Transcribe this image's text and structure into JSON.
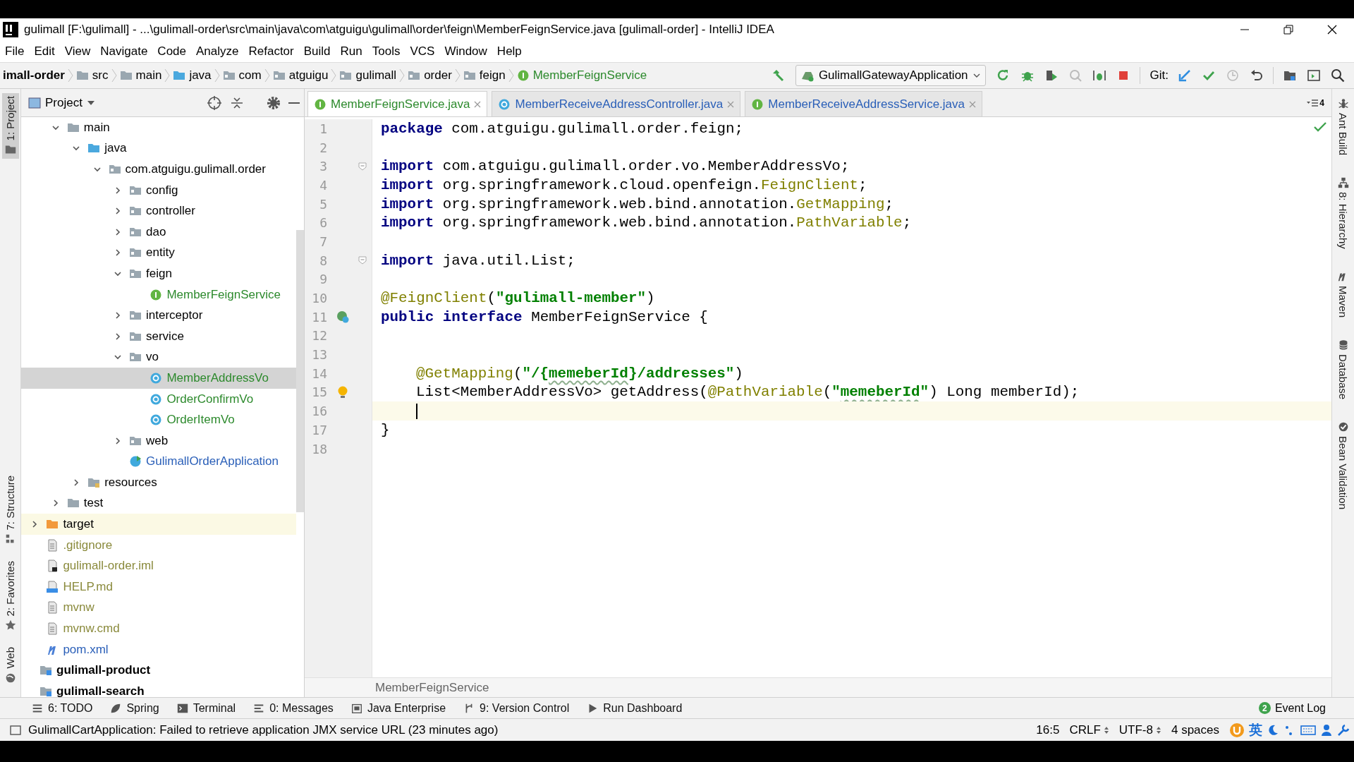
{
  "window": {
    "title": "gulimall [F:\\gulimall] - ...\\gulimall-order\\src\\main\\java\\com\\atguigu\\gulimall\\order\\feign\\MemberFeignService.java [gulimall-order] - IntelliJ IDEA"
  },
  "menu": [
    "File",
    "Edit",
    "View",
    "Navigate",
    "Code",
    "Analyze",
    "Refactor",
    "Build",
    "Run",
    "Tools",
    "VCS",
    "Window",
    "Help"
  ],
  "navbar": {
    "module": "imall-order",
    "crumbs": [
      {
        "label": "src",
        "kind": "folder"
      },
      {
        "label": "main",
        "kind": "folder"
      },
      {
        "label": "java",
        "kind": "source"
      },
      {
        "label": "com",
        "kind": "package"
      },
      {
        "label": "atguigu",
        "kind": "package"
      },
      {
        "label": "gulimall",
        "kind": "package"
      },
      {
        "label": "order",
        "kind": "package"
      },
      {
        "label": "feign",
        "kind": "package"
      },
      {
        "label": "MemberFeignService",
        "kind": "interface",
        "color": "#2d8a2d"
      }
    ],
    "run_config": "GulimallGatewayApplication",
    "git_label": "Git:",
    "tools": [
      {
        "kind": "rerun",
        "disabled": false
      },
      {
        "kind": "debug",
        "disabled": false
      },
      {
        "kind": "coverage",
        "disabled": false
      },
      {
        "kind": "profile",
        "disabled": true
      },
      {
        "kind": "attach",
        "disabled": false
      },
      {
        "kind": "stop",
        "disabled": false
      }
    ],
    "git_tools": [
      {
        "kind": "update",
        "disabled": false
      },
      {
        "kind": "commit",
        "disabled": false
      },
      {
        "kind": "history",
        "disabled": true
      },
      {
        "kind": "revert",
        "disabled": false
      }
    ]
  },
  "left_stripe": {
    "top": [
      {
        "label": "1: Project",
        "selected": true,
        "kind": "project"
      }
    ],
    "bottom": [
      {
        "label": "7: Structure",
        "selected": false,
        "kind": "structure"
      },
      {
        "label": "2: Favorites",
        "selected": false,
        "kind": "favorites"
      },
      {
        "label": "Web",
        "selected": false,
        "kind": "web"
      }
    ]
  },
  "right_stripe": [
    {
      "label": "Ant Build",
      "kind": "ant"
    },
    {
      "label": "8: Hierarchy",
      "kind": "hierarchy"
    },
    {
      "label": "Maven",
      "kind": "maven"
    },
    {
      "label": "Database",
      "kind": "database"
    },
    {
      "label": "Bean Validation",
      "kind": "bean"
    }
  ],
  "project_panel": {
    "title": "Project",
    "tree": [
      {
        "children": [
          {
            "children": [
              {
                "label": "main",
                "kind": "folder",
                "expanded": true,
                "children": [
                  {
                    "label": "java",
                    "kind": "source",
                    "expanded": true,
                    "children": [
                      {
                        "label": "com.atguigu.gulimall.order",
                        "kind": "package",
                        "expanded": true,
                        "children": [
                          {
                            "label": "config",
                            "kind": "package",
                            "expanded": false
                          },
                          {
                            "label": "controller",
                            "kind": "package",
                            "expanded": false
                          },
                          {
                            "label": "dao",
                            "kind": "package",
                            "expanded": false
                          },
                          {
                            "label": "entity",
                            "kind": "package",
                            "expanded": false
                          },
                          {
                            "label": "feign",
                            "kind": "package",
                            "expanded": true,
                            "children": [
                              {
                                "label": "MemberFeignService",
                                "kind": "interface",
                                "color": "#2d8a2d",
                                "selected": false
                              }
                            ]
                          },
                          {
                            "label": "interceptor",
                            "kind": "package",
                            "expanded": false
                          },
                          {
                            "label": "service",
                            "kind": "package",
                            "expanded": false
                          },
                          {
                            "label": "vo",
                            "kind": "package",
                            "expanded": true,
                            "children": [
                              {
                                "label": "MemberAddressVo",
                                "kind": "class",
                                "color": "#2d8a2d",
                                "selected": true
                              },
                              {
                                "label": "OrderConfirmVo",
                                "kind": "class",
                                "color": "#2d8a2d",
                                "selected": false
                              },
                              {
                                "label": "OrderItemVo",
                                "kind": "class",
                                "color": "#2d8a2d",
                                "selected": false
                              }
                            ]
                          },
                          {
                            "label": "web",
                            "kind": "package",
                            "expanded": false
                          },
                          {
                            "label": "GulimallOrderApplication",
                            "kind": "app",
                            "color": "#2a5fb8",
                            "selected": false
                          }
                        ]
                      }
                    ]
                  },
                  {
                    "label": "resources",
                    "kind": "resources",
                    "expanded": false
                  }
                ]
              },
              {
                "label": "test",
                "kind": "folder",
                "expanded": false
              }
            ]
          },
          {
            "label": "target",
            "kind": "excluded",
            "expanded": false,
            "highlighted": true
          },
          {
            "label": ".gitignore",
            "kind": "file",
            "color": "#8a8a3c"
          },
          {
            "label": "gulimall-order.iml",
            "kind": "iml",
            "color": "#8a8a3c"
          },
          {
            "label": "HELP.md",
            "kind": "md",
            "color": "#8a8a3c"
          },
          {
            "label": "mvnw",
            "kind": "file",
            "color": "#8a8a3c"
          },
          {
            "label": "mvnw.cmd",
            "kind": "file",
            "color": "#8a8a3c"
          },
          {
            "label": "pom.xml",
            "kind": "maven",
            "color": "#2a5fb8"
          }
        ]
      },
      {
        "label": "gulimall-product",
        "kind": "module"
      },
      {
        "label": "gulimall-search",
        "kind": "module"
      }
    ]
  },
  "editor": {
    "tabs": [
      {
        "label": "MemberFeignService.java",
        "kind": "interface",
        "color": "#2d8a2d",
        "selected": true
      },
      {
        "label": "MemberReceiveAddressController.java",
        "kind": "class",
        "color": "#2a5fb8",
        "selected": false
      },
      {
        "label": "MemberReceiveAddressService.java",
        "kind": "interface",
        "color": "#2a5fb8",
        "selected": false
      }
    ],
    "tab_count": "4",
    "lines": [
      {
        "number": "1",
        "tokens": [
          {
            "t": "package",
            "kind": "keyword"
          },
          {
            "t": " com.atguigu.gulimall.order.feign;",
            "kind": "plain"
          }
        ]
      },
      {
        "number": "2"
      },
      {
        "number": "3",
        "kind": "fold",
        "tokens": [
          {
            "t": "import",
            "kind": "keyword"
          },
          {
            "t": " com.atguigu.gulimall.order.vo.MemberAddressVo;",
            "kind": "plain"
          }
        ]
      },
      {
        "number": "4",
        "tokens": [
          {
            "t": "import",
            "kind": "keyword"
          },
          {
            "t": " org.springframework.cloud.openfeign.",
            "kind": "plain"
          },
          {
            "t": "FeignClient",
            "kind": "annotation"
          },
          {
            "t": ";",
            "kind": "plain"
          }
        ]
      },
      {
        "number": "5",
        "tokens": [
          {
            "t": "import",
            "kind": "keyword"
          },
          {
            "t": " org.springframework.web.bind.annotation.",
            "kind": "plain"
          },
          {
            "t": "GetMapping",
            "kind": "annotation"
          },
          {
            "t": ";",
            "kind": "plain"
          }
        ]
      },
      {
        "number": "6",
        "tokens": [
          {
            "t": "import",
            "kind": "keyword"
          },
          {
            "t": " org.springframework.web.bind.annotation.",
            "kind": "plain"
          },
          {
            "t": "PathVariable",
            "kind": "annotation"
          },
          {
            "t": ";",
            "kind": "plain"
          }
        ]
      },
      {
        "number": "7"
      },
      {
        "number": "8",
        "kind": "fold",
        "tokens": [
          {
            "t": "import",
            "kind": "keyword"
          },
          {
            "t": " java.util.List;",
            "kind": "plain"
          }
        ]
      },
      {
        "number": "9"
      },
      {
        "number": "10",
        "tokens": [
          {
            "t": "@FeignClient",
            "kind": "annotation"
          },
          {
            "t": "(",
            "kind": "plain"
          },
          {
            "t": "\"gulimall-member\"",
            "kind": "string"
          },
          {
            "t": ")",
            "kind": "plain"
          }
        ]
      },
      {
        "number": "11",
        "kind": "implemented",
        "tokens": [
          {
            "t": "public interface",
            "kind": "keyword"
          },
          {
            "t": " MemberFeignService {",
            "kind": "plain"
          }
        ]
      },
      {
        "number": "12"
      },
      {
        "number": "13"
      },
      {
        "number": "14",
        "indented": true,
        "tokens": [
          {
            "t": "@GetMapping",
            "kind": "annotation"
          },
          {
            "t": "(",
            "kind": "plain"
          },
          {
            "t": "\"/{",
            "kind": "string"
          },
          {
            "t": "memeberId",
            "kind": "string",
            "typo": true
          },
          {
            "t": "}/addresses\"",
            "kind": "string"
          },
          {
            "t": ")",
            "kind": "plain"
          }
        ]
      },
      {
        "number": "15",
        "indented": true,
        "kind": "bulb",
        "tokens": [
          {
            "t": "List<MemberAddressVo> getAddress(",
            "kind": "plain"
          },
          {
            "t": "@PathVariable",
            "kind": "annotation"
          },
          {
            "t": "(",
            "kind": "plain"
          },
          {
            "t": "\"",
            "kind": "string"
          },
          {
            "t": "memeberId",
            "kind": "string",
            "typo": true
          },
          {
            "t": "\"",
            "kind": "string"
          },
          {
            "t": ") Long memberId);",
            "kind": "plain"
          }
        ]
      },
      {
        "number": "16",
        "indented": true,
        "current": true
      },
      {
        "number": "17",
        "tokens": [
          {
            "t": "}",
            "kind": "plain"
          }
        ]
      },
      {
        "number": "18"
      }
    ],
    "breadcrumb": "MemberFeignService"
  },
  "tool_stripe": [
    {
      "label": "6: TODO",
      "kind": "todo"
    },
    {
      "label": "Spring",
      "kind": "spring"
    },
    {
      "label": "Terminal",
      "kind": "terminal"
    },
    {
      "label": "0: Messages",
      "kind": "messages"
    },
    {
      "label": "Java Enterprise",
      "kind": "javaee"
    },
    {
      "label": "9: Version Control",
      "kind": "vcs"
    },
    {
      "label": "Run Dashboard",
      "kind": "run"
    }
  ],
  "event_log": {
    "label": "Event Log",
    "count": "2"
  },
  "status_bar": {
    "message": "GulimallCartApplication: Failed to retrieve application JMX service URL (23 minutes ago)",
    "position": "16:5",
    "line_separator": "CRLF",
    "encoding": "UTF-8",
    "indent": "4 spaces",
    "ime_label": "英"
  }
}
